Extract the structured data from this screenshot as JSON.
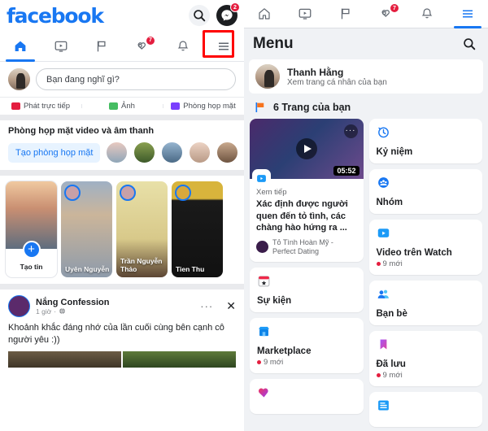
{
  "left_panel": {
    "brand": "facebook",
    "search_icon": "search-icon",
    "messenger_icon": "messenger-icon",
    "messenger_badge": "2",
    "tabs": [
      {
        "name": "home",
        "icon": "home-icon",
        "active": true,
        "badge": ""
      },
      {
        "name": "watch",
        "icon": "watch-video-icon",
        "active": false,
        "badge": ""
      },
      {
        "name": "pages",
        "icon": "flag-icon",
        "active": false,
        "badge": ""
      },
      {
        "name": "notifications-hearts",
        "icon": "hearts-icon",
        "active": false,
        "badge": "7"
      },
      {
        "name": "bell",
        "icon": "bell-icon",
        "active": false,
        "badge": ""
      },
      {
        "name": "menu",
        "icon": "hamburger-menu-icon",
        "active": false,
        "badge": "",
        "highlighted": true
      }
    ],
    "composer": {
      "placeholder": "Bạn đang nghĩ gì?",
      "avatar": "user-avatar"
    },
    "post_actions": [
      {
        "label": "Phát trực tiếp",
        "icon": "live-video-icon",
        "color": "#E41E3F"
      },
      {
        "label": "Ảnh",
        "icon": "photo-icon",
        "color": "#45BD62"
      },
      {
        "label": "Phòng họp mặt",
        "icon": "room-video-icon",
        "color": "#7A3FFD"
      }
    ],
    "rooms": {
      "title": "Phòng họp mặt video và âm thanh",
      "create_button": "Tạo phòng họp mặt",
      "avatars": [
        "friend-1",
        "friend-2",
        "friend-3",
        "friend-4",
        "friend-5"
      ]
    },
    "stories": [
      {
        "label": "Tạo tin",
        "type": "create"
      },
      {
        "label": "Uyên Nguyễn",
        "type": "story"
      },
      {
        "label": "Trần Nguyễn Thảo",
        "type": "story"
      },
      {
        "label": "Tien Thu",
        "type": "story"
      }
    ],
    "post": {
      "page_name": "Nắng Confession",
      "time": "1 giờ",
      "privacy_icon": "globe-icon",
      "more_icon": "more-options-icon",
      "close_icon": "close-icon",
      "text": "Khoảnh khắc đáng nhớ của lần cuối cùng bên cạnh cô người yêu :))"
    }
  },
  "right_panel": {
    "tabs": [
      {
        "name": "home",
        "icon": "home-icon",
        "active": false,
        "badge": ""
      },
      {
        "name": "watch",
        "icon": "watch-video-icon",
        "active": false,
        "badge": ""
      },
      {
        "name": "pages",
        "icon": "flag-icon",
        "active": false,
        "badge": ""
      },
      {
        "name": "notifications-hearts",
        "icon": "hearts-icon",
        "active": false,
        "badge": "7"
      },
      {
        "name": "bell",
        "icon": "bell-icon",
        "active": false,
        "badge": ""
      },
      {
        "name": "menu",
        "icon": "hamburger-menu-icon",
        "active": true,
        "badge": ""
      }
    ],
    "header": {
      "title": "Menu",
      "search_icon": "search-icon"
    },
    "profile": {
      "name": "Thanh Hằng",
      "subtitle": "Xem trang cá nhân của bạn",
      "avatar": "user-avatar",
      "highlighted": true
    },
    "pages_section": {
      "icon": "flag-icon",
      "label": "6 Trang của bạn"
    },
    "video_card": {
      "continue_label": "Xem tiếp",
      "title": "Xác định được người quen đến tỏ tình, các chàng hào hứng ra ...",
      "source": "Tỏ Tình Hoàn Mỹ - Perfect Dating",
      "duration": "05:52",
      "play_icon": "play-icon",
      "dots_icon": "more-options-icon",
      "watch_badge_icon": "watch-video-icon"
    },
    "menu_items_left": [
      {
        "label": "Sự kiện",
        "icon": "calendar-star-icon",
        "badge": ""
      },
      {
        "label": "Marketplace",
        "icon": "store-icon",
        "badge": "9 mới"
      },
      {
        "label": "",
        "icon": "heart-icon",
        "badge": ""
      }
    ],
    "menu_items_right": [
      {
        "label": "Kỷ niệm",
        "icon": "clock-memories-icon",
        "badge": ""
      },
      {
        "label": "Nhóm",
        "icon": "groups-icon",
        "badge": ""
      },
      {
        "label": "Video trên Watch",
        "icon": "watch-video-icon",
        "badge": "9 mới"
      },
      {
        "label": "Bạn bè",
        "icon": "friends-icon",
        "badge": ""
      },
      {
        "label": "Đã lưu",
        "icon": "bookmark-icon",
        "badge": "9 mới"
      },
      {
        "label": "",
        "icon": "news-icon",
        "badge": ""
      }
    ]
  },
  "colors": {
    "brand_blue": "#1877F2",
    "highlight_red": "#FF0000",
    "badge_red": "#E41E3F",
    "bg_grey": "#F0F2F5"
  }
}
